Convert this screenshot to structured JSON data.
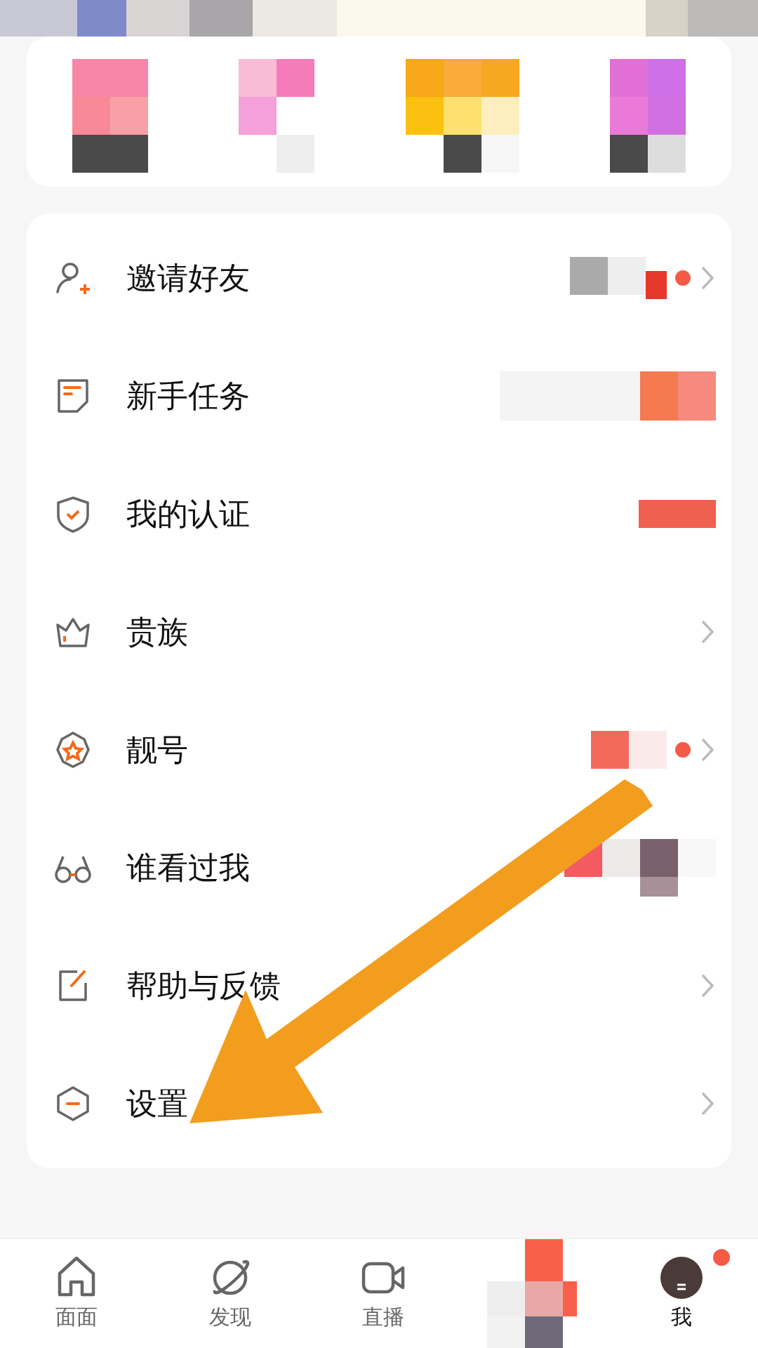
{
  "shortcuts": [
    {
      "kind": "picture"
    },
    {
      "kind": "picture"
    },
    {
      "kind": "picture"
    },
    {
      "kind": "picture"
    }
  ],
  "menu": [
    {
      "label": "邀请好友",
      "extra": {
        "kind": "picture"
      },
      "dot": true,
      "chevron": true
    },
    {
      "label": "新手任务",
      "extra": {
        "kind": "picture"
      }
    },
    {
      "label": "我的认证",
      "extra": {
        "kind": "picture"
      }
    },
    {
      "label": "贵族",
      "chevron": true
    },
    {
      "label": "靓号",
      "extra": {
        "kind": "picture"
      },
      "dot": true,
      "chevron": true
    },
    {
      "label": "谁看过我",
      "extra": {
        "kind": "picture"
      }
    },
    {
      "label": "帮助与反馈",
      "chevron": true
    },
    {
      "label": "设置",
      "chevron": true
    }
  ],
  "tabs": [
    {
      "kind": "tab",
      "label": "面面",
      "selected": false
    },
    {
      "kind": "tab",
      "label": "发现",
      "selected": false
    },
    {
      "kind": "tab",
      "label": "直播",
      "selected": false
    },
    {
      "kind": "picture"
    },
    {
      "kind": "tab",
      "label": "我",
      "selected": true,
      "dot": true
    }
  ]
}
